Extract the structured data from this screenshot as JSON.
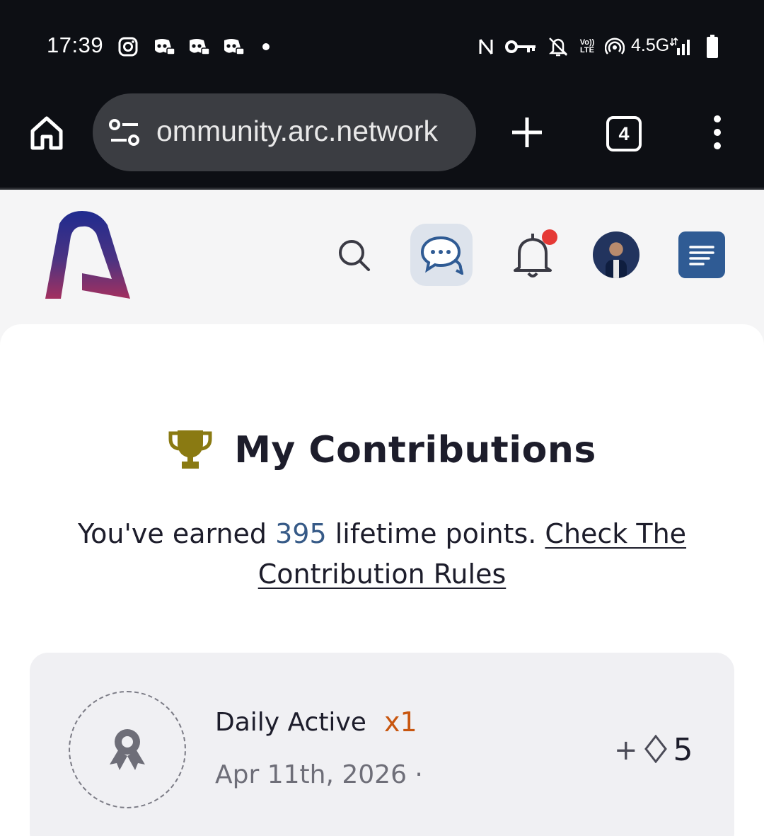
{
  "status_bar": {
    "time": "17:39",
    "network": "4.5G",
    "notification_icons": [
      "instagram-icon",
      "discord-icon",
      "discord-icon",
      "discord-icon",
      "dot-icon"
    ],
    "system_icons": [
      "nfc-icon",
      "vpn-key-icon",
      "bell-off-icon",
      "volte-icon",
      "hotspot-icon",
      "signal-icon",
      "battery-icon"
    ]
  },
  "browser": {
    "url": "community.arc.network",
    "url_visible": "ommunity.arc.network",
    "tab_count": "4"
  },
  "header": {
    "notification_badge_color": "#e53935",
    "menu_color": "#2f5b94"
  },
  "contributions": {
    "title": "My Contributions",
    "summary_prefix": "You've earned ",
    "points": "395",
    "summary_middle": " lifetime points. ",
    "rules_link": "Check The Contribution Rules",
    "items": [
      {
        "title": "Daily Active",
        "multiplier": "x1",
        "date": "Apr 11th, 2026 ·",
        "points_prefix": "+",
        "points": "5"
      }
    ]
  },
  "colors": {
    "trophy": "#8a7a12",
    "points_highlight": "#365a87",
    "multiplier": "#c8560f"
  }
}
